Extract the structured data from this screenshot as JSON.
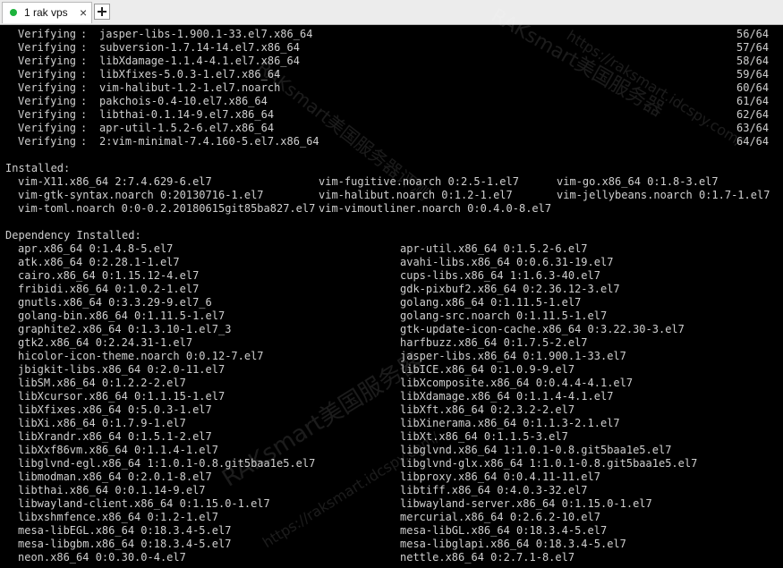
{
  "tab": {
    "label": "1 rak vps"
  },
  "verifying": [
    [
      "Verifying",
      "jasper-libs-1.900.1-33.el7.x86_64",
      "56/64"
    ],
    [
      "Verifying",
      "subversion-1.7.14-14.el7.x86_64",
      "57/64"
    ],
    [
      "Verifying",
      "libXdamage-1.1.4-4.1.el7.x86_64",
      "58/64"
    ],
    [
      "Verifying",
      "libXfixes-5.0.3-1.el7.x86_64",
      "59/64"
    ],
    [
      "Verifying",
      "vim-halibut-1.2-1.el7.noarch",
      "60/64"
    ],
    [
      "Verifying",
      "pakchois-0.4-10.el7.x86_64",
      "61/64"
    ],
    [
      "Verifying",
      "libthai-0.1.14-9.el7.x86_64",
      "62/64"
    ],
    [
      "Verifying",
      "apr-util-1.5.2-6.el7.x86_64",
      "63/64"
    ],
    [
      "Verifying",
      "2:vim-minimal-7.4.160-5.el7.x86_64",
      "64/64"
    ]
  ],
  "installed_heading": "Installed:",
  "installed": [
    [
      "vim-X11.x86_64 2:7.4.629-6.el7",
      "vim-fugitive.noarch 0:2.5-1.el7",
      "vim-go.x86_64 0:1.8-3.el7"
    ],
    [
      "vim-gtk-syntax.noarch 0:20130716-1.el7",
      "vim-halibut.noarch 0:1.2-1.el7",
      "vim-jellybeans.noarch 0:1.7-1.el7"
    ],
    [
      "vim-toml.noarch 0:0-0.2.20180615git85ba827.el7",
      "vim-vimoutliner.noarch 0:0.4.0-8.el7",
      ""
    ]
  ],
  "dependency_heading": "Dependency Installed:",
  "dependency": [
    [
      "apr.x86_64 0:1.4.8-5.el7",
      "apr-util.x86_64 0:1.5.2-6.el7"
    ],
    [
      "atk.x86_64 0:2.28.1-1.el7",
      "avahi-libs.x86_64 0:0.6.31-19.el7"
    ],
    [
      "cairo.x86_64 0:1.15.12-4.el7",
      "cups-libs.x86_64 1:1.6.3-40.el7"
    ],
    [
      "fribidi.x86_64 0:1.0.2-1.el7",
      "gdk-pixbuf2.x86_64 0:2.36.12-3.el7"
    ],
    [
      "gnutls.x86_64 0:3.3.29-9.el7_6",
      "golang.x86_64 0:1.11.5-1.el7"
    ],
    [
      "golang-bin.x86_64 0:1.11.5-1.el7",
      "golang-src.noarch 0:1.11.5-1.el7"
    ],
    [
      "graphite2.x86_64 0:1.3.10-1.el7_3",
      "gtk-update-icon-cache.x86_64 0:3.22.30-3.el7"
    ],
    [
      "gtk2.x86_64 0:2.24.31-1.el7",
      "harfbuzz.x86_64 0:1.7.5-2.el7"
    ],
    [
      "hicolor-icon-theme.noarch 0:0.12-7.el7",
      "jasper-libs.x86_64 0:1.900.1-33.el7"
    ],
    [
      "jbigkit-libs.x86_64 0:2.0-11.el7",
      "libICE.x86_64 0:1.0.9-9.el7"
    ],
    [
      "libSM.x86_64 0:1.2.2-2.el7",
      "libXcomposite.x86_64 0:0.4.4-4.1.el7"
    ],
    [
      "libXcursor.x86_64 0:1.1.15-1.el7",
      "libXdamage.x86_64 0:1.1.4-4.1.el7"
    ],
    [
      "libXfixes.x86_64 0:5.0.3-1.el7",
      "libXft.x86_64 0:2.3.2-2.el7"
    ],
    [
      "libXi.x86_64 0:1.7.9-1.el7",
      "libXinerama.x86_64 0:1.1.3-2.1.el7"
    ],
    [
      "libXrandr.x86_64 0:1.5.1-2.el7",
      "libXt.x86_64 0:1.1.5-3.el7"
    ],
    [
      "libXxf86vm.x86_64 0:1.1.4-1.el7",
      "libglvnd.x86_64 1:1.0.1-0.8.git5baa1e5.el7"
    ],
    [
      "libglvnd-egl.x86_64 1:1.0.1-0.8.git5baa1e5.el7",
      "libglvnd-glx.x86_64 1:1.0.1-0.8.git5baa1e5.el7"
    ],
    [
      "libmodman.x86_64 0:2.0.1-8.el7",
      "libproxy.x86_64 0:0.4.11-11.el7"
    ],
    [
      "libthai.x86_64 0:0.1.14-9.el7",
      "libtiff.x86_64 0:4.0.3-32.el7"
    ],
    [
      "libwayland-client.x86_64 0:1.15.0-1.el7",
      "libwayland-server.x86_64 0:1.15.0-1.el7"
    ],
    [
      "libxshmfence.x86_64 0:1.2-1.el7",
      "mercurial.x86_64 0:2.6.2-10.el7"
    ],
    [
      "mesa-libEGL.x86_64 0:18.3.4-5.el7",
      "mesa-libGL.x86_64 0:18.3.4-5.el7"
    ],
    [
      "mesa-libgbm.x86_64 0:18.3.4-5.el7",
      "mesa-libglapi.x86_64 0:18.3.4-5.el7"
    ],
    [
      "neon.x86_64 0:0.30.0-4.el7",
      "nettle.x86_64 0:2.7.1-8.el7"
    ]
  ],
  "watermarks": [
    "RAKsmart美国服务器",
    "https://raksmart.idcspy.com/",
    "RAKsmart美国服务器",
    "https://raksmart.idcspy.com/",
    "RAKsmart美国服务器评测"
  ],
  "colors": {
    "tab_dot": "#1db33c",
    "terminal_bg": "#000000",
    "terminal_fg": "#cfcfcf"
  }
}
